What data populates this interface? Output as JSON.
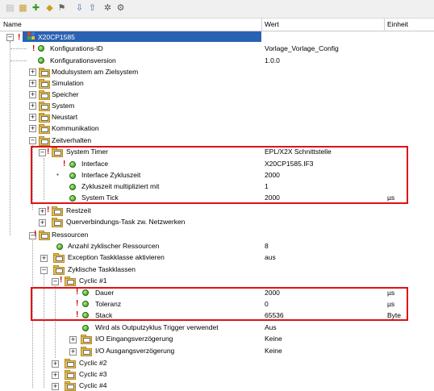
{
  "toolbar": {
    "icons": [
      "tree-icon",
      "grid-icon",
      "add-icon",
      "settings-icon",
      "filter-icon",
      "sort-down-icon",
      "sort-up-icon",
      "refresh-icon",
      "config-icon"
    ]
  },
  "header": {
    "col_name": "Name",
    "col_value": "Wert",
    "col_unit": "Einheit"
  },
  "tree": {
    "root": {
      "label": "X20CP1585"
    },
    "rows": [
      {
        "label": "Konfigurations-ID",
        "value": "Vorlage_Vorlage_Config",
        "unit": ""
      },
      {
        "label": "Konfigurationsversion",
        "value": "1.0.0",
        "unit": ""
      },
      {
        "label": "Modulsystem am Zielsystem",
        "value": "",
        "unit": ""
      },
      {
        "label": "Simulation",
        "value": "",
        "unit": ""
      },
      {
        "label": "Speicher",
        "value": "",
        "unit": ""
      },
      {
        "label": "System",
        "value": "",
        "unit": ""
      },
      {
        "label": "Neustart",
        "value": "",
        "unit": ""
      },
      {
        "label": "Kommunikation",
        "value": "",
        "unit": ""
      },
      {
        "label": "Zeitverhalten",
        "value": "",
        "unit": ""
      },
      {
        "label": "System Timer",
        "value": "EPL/X2X Schnittstelle",
        "unit": ""
      },
      {
        "label": "Interface",
        "value": "X20CP1585.IF3",
        "unit": ""
      },
      {
        "label": "Interface Zykluszeit",
        "value": "2000",
        "unit": ""
      },
      {
        "label": "Zykluszeit multipliziert mit",
        "value": "1",
        "unit": ""
      },
      {
        "label": "System Tick",
        "value": "2000",
        "unit": "µs"
      },
      {
        "label": "Restzeit",
        "value": "",
        "unit": ""
      },
      {
        "label": "Querverbindungs-Task zw. Netzwerken",
        "value": "",
        "unit": ""
      },
      {
        "label": "Ressourcen",
        "value": "",
        "unit": ""
      },
      {
        "label": "Anzahl zyklischer Ressourcen",
        "value": "8",
        "unit": ""
      },
      {
        "label": "Exception Taskklasse aktivieren",
        "value": "aus",
        "unit": ""
      },
      {
        "label": "Zyklische Taskklassen",
        "value": "",
        "unit": ""
      },
      {
        "label": "Cyclic #1",
        "value": "",
        "unit": ""
      },
      {
        "label": "Dauer",
        "value": "2000",
        "unit": "µs"
      },
      {
        "label": "Toleranz",
        "value": "0",
        "unit": "µs"
      },
      {
        "label": "Stack",
        "value": "65536",
        "unit": "Byte"
      },
      {
        "label": "Wird als Outputzyklus Trigger verwendet",
        "value": "Aus",
        "unit": ""
      },
      {
        "label": "I/O Eingangsverzögerung",
        "value": "Keine",
        "unit": ""
      },
      {
        "label": "I/O Ausgangsverzögerung",
        "value": "Keine",
        "unit": ""
      },
      {
        "label": "Cyclic #2",
        "value": "",
        "unit": ""
      },
      {
        "label": "Cyclic #3",
        "value": "",
        "unit": ""
      },
      {
        "label": "Cyclic #4",
        "value": "",
        "unit": ""
      }
    ]
  },
  "colors": {
    "highlight_box": "#e01018",
    "selection": "#2a62b3",
    "status_ok": "#2a8a12",
    "required_mark": "#d00000"
  }
}
